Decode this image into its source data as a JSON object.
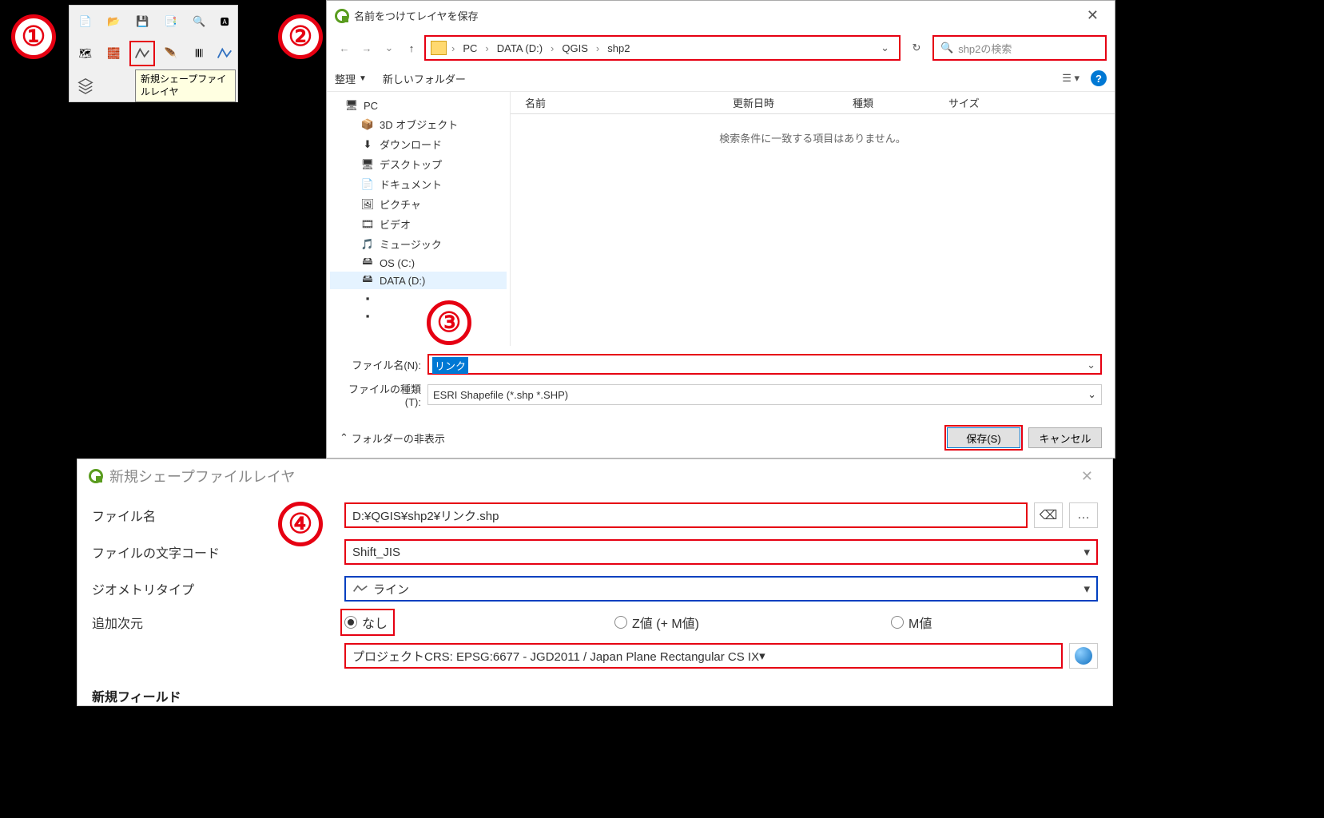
{
  "step1": {
    "tooltip": "新規シェープファイルレイヤ"
  },
  "step2": {
    "title": "名前をつけてレイヤを保存",
    "breadcrumb": [
      "PC",
      "DATA (D:)",
      "QGIS",
      "shp2"
    ],
    "search_placeholder": "shp2の検索",
    "organize": "整理",
    "new_folder": "新しいフォルダー",
    "tree": {
      "pc": "PC",
      "objects3d": "3D オブジェクト",
      "downloads": "ダウンロード",
      "desktop": "デスクトップ",
      "documents": "ドキュメント",
      "pictures": "ピクチャ",
      "videos": "ビデオ",
      "music": "ミュージック",
      "osc": "OS (C:)",
      "datad": "DATA (D:)"
    },
    "cols": {
      "name": "名前",
      "date": "更新日時",
      "type": "種類",
      "size": "サイズ"
    },
    "empty_msg": "検索条件に一致する項目はありません。",
    "filename_label": "ファイル名(N):",
    "filename_value": "リンク",
    "filetype_label": "ファイルの種類(T):",
    "filetype_value": "ESRI Shapefile (*.shp *.SHP)",
    "hide_folders": "フォルダーの非表示",
    "save_btn": "保存(S)",
    "cancel_btn": "キャンセル"
  },
  "step4": {
    "title": "新規シェープファイルレイヤ",
    "filename_label": "ファイル名",
    "filename_value": "D:¥QGIS¥shp2¥リンク.shp",
    "encoding_label": "ファイルの文字コード",
    "encoding_value": "Shift_JIS",
    "geomtype_label": "ジオメトリタイプ",
    "geomtype_value": "ライン",
    "dimension_label": "追加次元",
    "dim_none": "なし",
    "dim_z": "Z値 (+ M値)",
    "dim_m": "M値",
    "crs_value": "プロジェクトCRS: EPSG:6677 - JGD2011 / Japan Plane Rectangular CS IX",
    "new_field": "新規フィールド"
  }
}
